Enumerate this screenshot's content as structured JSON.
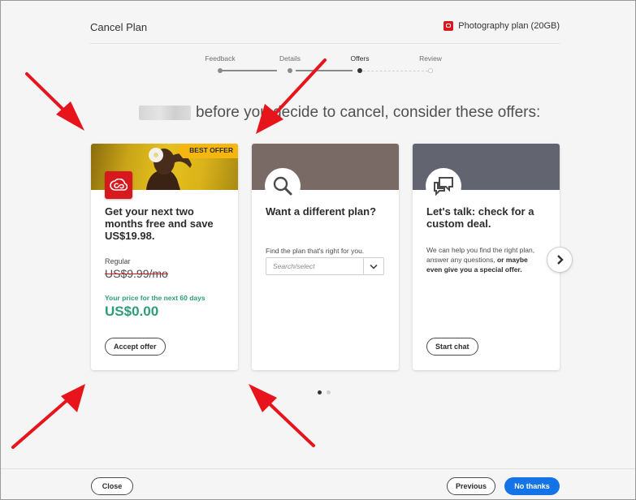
{
  "header": {
    "title": "Cancel Plan",
    "plan_name": "Photography plan (20GB)"
  },
  "stepper": {
    "steps": [
      {
        "label": "Feedback",
        "state": "done"
      },
      {
        "label": "Details",
        "state": "done"
      },
      {
        "label": "Offers",
        "state": "active"
      },
      {
        "label": "Review",
        "state": "future"
      }
    ]
  },
  "heading": {
    "text": "before you decide to cancel, consider these offers:"
  },
  "offers": [
    {
      "badge": "BEST OFFER",
      "title": "Get your next two months free and save US$19.98.",
      "regular_label": "Regular",
      "regular_price": "US$9.99/mo",
      "promo_label": "Your price for the next 60 days",
      "promo_price": "US$0.00",
      "button": "Accept offer"
    },
    {
      "title": "Want a different plan?",
      "text": "Find the plan that's right for you.",
      "select_placeholder": "Search/select"
    },
    {
      "title": "Let's talk: check for a custom deal.",
      "text_plain": "We can help you find the right plan, answer any questions, ",
      "text_bold": "or maybe even give you a special offer.",
      "button": "Start chat"
    }
  ],
  "pagination": {
    "current": 1,
    "total": 2
  },
  "footer": {
    "close": "Close",
    "previous": "Previous",
    "no_thanks": "No thanks"
  },
  "colors": {
    "primary": "#1473e6",
    "promo_green": "#2d9d78",
    "badge_yellow": "#f5b60f",
    "brand_red": "#d7191e",
    "annotation_red": "#e8141c"
  }
}
